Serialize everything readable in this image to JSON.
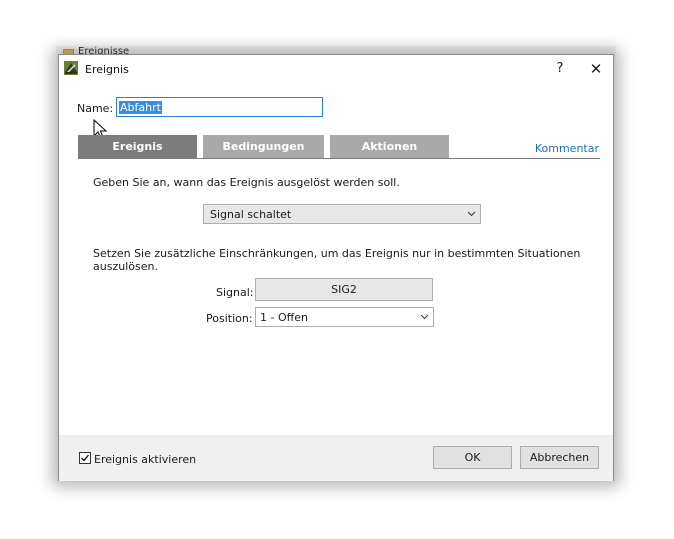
{
  "background_window": {
    "title": "Ereignisse"
  },
  "dialog": {
    "title": "Ereignis",
    "help_label": "?",
    "close_label": "✕"
  },
  "name": {
    "label": "Name:",
    "value": "Abfahrt"
  },
  "tabs": [
    {
      "label": "Ereignis",
      "active": true
    },
    {
      "label": "Bedingungen",
      "active": false
    },
    {
      "label": "Aktionen",
      "active": false
    }
  ],
  "comment_link": "Kommentar",
  "trigger": {
    "instruction": "Geben Sie an, wann das Ereignis ausgelöst werden soll.",
    "selected": "Signal schaltet"
  },
  "restrictions": {
    "instruction": "Setzen Sie zusätzliche Einschränkungen, um das Ereignis nur in bestimmten Situationen auszulösen.",
    "signal_label": "Signal:",
    "signal_value": "SIG2",
    "position_label": "Position:",
    "position_selected": "1 - Offen"
  },
  "footer": {
    "enable_label": "Ereignis aktivieren",
    "enable_checked": true,
    "ok_label": "OK",
    "cancel_label": "Abbrechen"
  },
  "colors": {
    "tab_active": "#7c7c7c",
    "tab_inactive": "#a9a9a9",
    "link": "#1e6fbf",
    "selection": "#3a8de0"
  }
}
